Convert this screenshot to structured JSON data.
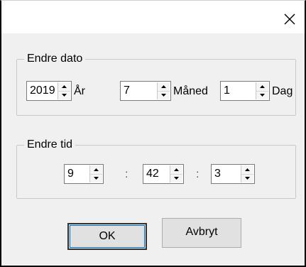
{
  "titlebar": {
    "close_icon": "close-icon"
  },
  "date_group": {
    "title": "Endre dato",
    "year": {
      "value": "2019",
      "unit": "År"
    },
    "month": {
      "value": "7",
      "unit": "Måned"
    },
    "day": {
      "value": "1",
      "unit": "Dag"
    }
  },
  "time_group": {
    "title": "Endre tid",
    "hour": {
      "value": "9"
    },
    "minute": {
      "value": "42"
    },
    "second": {
      "value": "3"
    },
    "separator": ":"
  },
  "buttons": {
    "ok_label": "OK",
    "cancel_label": "Avbryt"
  }
}
